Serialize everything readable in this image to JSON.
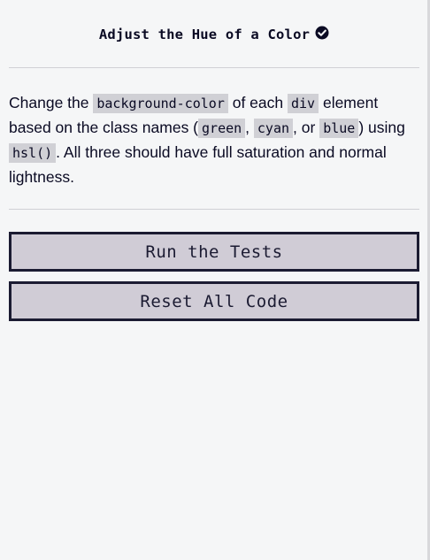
{
  "challenge": {
    "title": "Adjust the Hue of a Color",
    "completed_icon": "check-circle-icon"
  },
  "description": {
    "t1": "Change the ",
    "c1": "background-color",
    "t2": " of each ",
    "c2": "div",
    "t3": " element based on the class names (",
    "c3": "green",
    "t4": ", ",
    "c4": "cyan",
    "t5": ", or ",
    "c5": "blue",
    "t6": ") using ",
    "c6": "hsl()",
    "t7": ". All three should have full saturation and normal lightness."
  },
  "buttons": {
    "run_label": "Run the Tests",
    "reset_label": "Reset All Code"
  },
  "colors": {
    "background": "#f5f6f7",
    "text": "#0a0a23",
    "code_bg": "#d0d0d5",
    "button_bg": "#d0ccd6",
    "button_border": "#1b1b32"
  }
}
